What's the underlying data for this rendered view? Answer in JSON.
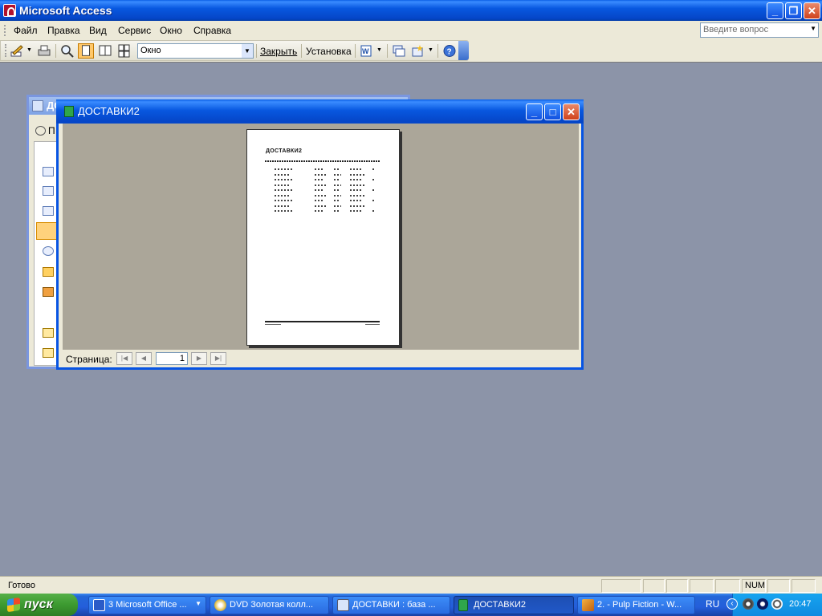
{
  "app": {
    "title": "Microsoft Access"
  },
  "menu": {
    "items": [
      "Файл",
      "Правка",
      "Вид",
      "Сервис",
      "Окно",
      "Справка"
    ],
    "ask_placeholder": "Введите вопрос"
  },
  "toolbar": {
    "zoom_value": "Окно",
    "close_label": "Закрыть",
    "setup_label": "Установка"
  },
  "db_window": {
    "title": "ДО",
    "toolbar_label": "П"
  },
  "report_window": {
    "title": "ДОСТАВКИ2",
    "page_heading": "ДОСТАВКИ2",
    "page_label": "Страница:",
    "page_number": "1"
  },
  "status": {
    "text": "Готово",
    "num": "NUM"
  },
  "taskbar": {
    "start_label": "пуск",
    "tasks": [
      "3 Microsoft Office ...",
      "DVD Золотая колл...",
      "ДОСТАВКИ : база ...",
      "ДОСТАВКИ2",
      "2. - Pulp Fiction - W..."
    ],
    "language": "RU",
    "clock": "20:47"
  }
}
